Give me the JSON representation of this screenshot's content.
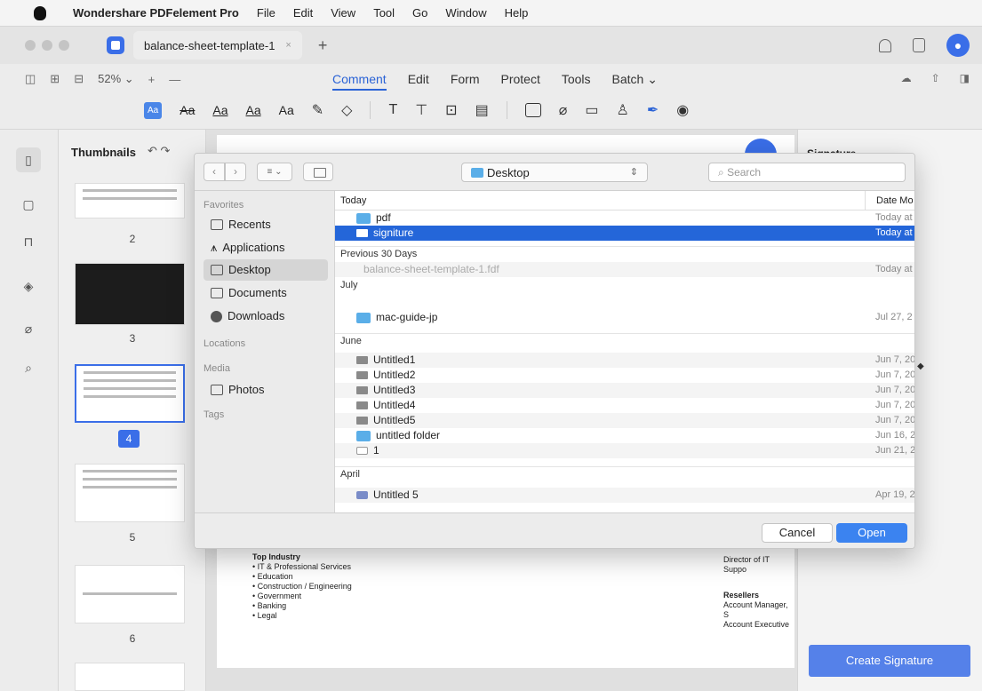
{
  "menubar": {
    "app_name": "Wondershare PDFelement Pro",
    "items": [
      "File",
      "Edit",
      "View",
      "Tool",
      "Go",
      "Window",
      "Help"
    ]
  },
  "tabbar": {
    "doc_tab": "balance-sheet-template-1",
    "close": "×",
    "new_tab": "+"
  },
  "toolbar1": {
    "zoom": "52%",
    "zoom_chevron": "⌄",
    "zoom_in": "+",
    "zoom_out": "—",
    "tabs": [
      "Comment",
      "Edit",
      "Form",
      "Protect",
      "Tools",
      "Batch ⌄"
    ]
  },
  "toolbar2": {
    "highlight": "Aa",
    "strike": "Aa",
    "underline": "Aa",
    "squiggly": "Aa",
    "caret": "Aa"
  },
  "thumbnails": {
    "title": "Thumbnails",
    "rotate": "↶ ↷",
    "pages": [
      "2",
      "3",
      "4",
      "5",
      "6"
    ]
  },
  "document": {
    "top_industries": "Top Industry",
    "list": [
      "• IT & Professional Services",
      "• Education",
      "• Construction / Engineering",
      "• Government",
      "• Banking",
      "• Legal"
    ],
    "right_partial": "Director of IT Suppo",
    "resellers": "Resellers",
    "reseller_lines": [
      "Account Manager, S",
      "Account Executive"
    ]
  },
  "right_panel": {
    "title": "Signature",
    "create_button": "Create Signature"
  },
  "dialog": {
    "location": "Desktop",
    "search_placeholder": "Search",
    "sidebar": {
      "favorites_header": "Favorites",
      "favorites": [
        "Recents",
        "Applications",
        "Desktop",
        "Documents",
        "Downloads"
      ],
      "locations_header": "Locations",
      "media_header": "Media",
      "media": [
        "Photos"
      ],
      "tags_header": "Tags"
    },
    "list": {
      "col_name": "Today",
      "col_date": "Date Mo",
      "groups": {
        "today": "Today",
        "prev30": "Previous 30 Days",
        "july": "July",
        "june": "June",
        "april": "April"
      },
      "rows": {
        "pdf": {
          "name": "pdf",
          "date": "Today at"
        },
        "signiture": {
          "name": "signiture",
          "date": "Today at"
        },
        "fdf": {
          "name": "balance-sheet-template-1.fdf",
          "date": "Today at"
        },
        "macguide": {
          "name": "mac-guide-jp",
          "date": "Jul 27, 2"
        },
        "u1": {
          "name": "Untitled1",
          "date": "Jun 7, 20"
        },
        "u2": {
          "name": "Untitled2",
          "date": "Jun 7, 20"
        },
        "u3": {
          "name": "Untitled3",
          "date": "Jun 7, 20"
        },
        "u4": {
          "name": "Untitled4",
          "date": "Jun 7, 20"
        },
        "u5": {
          "name": "Untitled5",
          "date": "Jun 7, 20"
        },
        "uf": {
          "name": "untitled folder",
          "date": "Jun 16, 2"
        },
        "one": {
          "name": "1",
          "date": "Jun 21, 2"
        },
        "u5b": {
          "name": "Untitled 5",
          "date": "Apr 19, 2"
        }
      }
    },
    "cancel": "Cancel",
    "open": "Open"
  }
}
